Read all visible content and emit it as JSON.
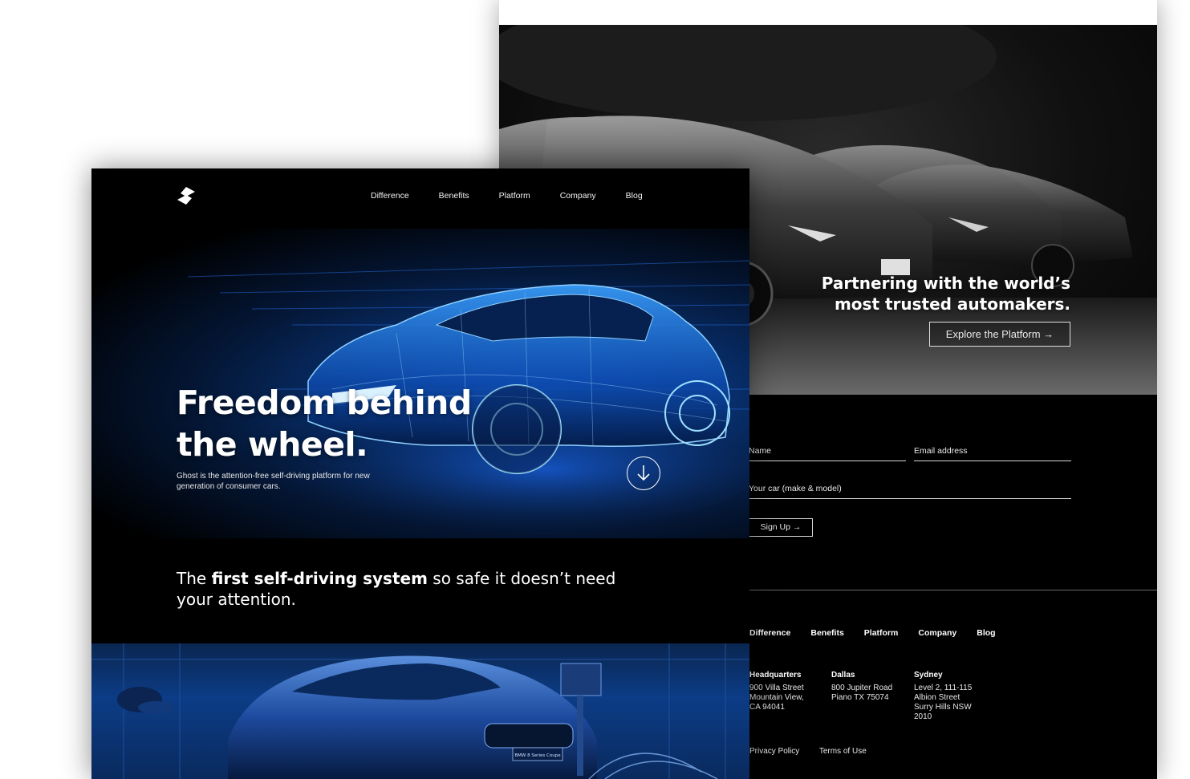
{
  "brand": {
    "accent_blue": "#1a6cff",
    "background": "#000000",
    "logo_icon": "ghost-logo-icon"
  },
  "nav": {
    "items": [
      "Difference",
      "Benefits",
      "Platform",
      "Company",
      "Blog"
    ]
  },
  "hero": {
    "title": "Freedom behind\nthe wheel.",
    "subtitle": "Ghost is the attention-free self-driving platform for new generation of consumer cars.",
    "scroll_icon": "arrow-down-circle-icon"
  },
  "tagline": {
    "prefix": "The ",
    "emphasis": "first self-driving system",
    "suffix": " so safe it doesn’t need your attention."
  },
  "showroom": {
    "plate_text": "BMW 8 Series Coupe"
  },
  "partners": {
    "heading": "Partnering with the world’s\nmost trusted automakers.",
    "cta_label": "Explore the Platform →"
  },
  "signup_form": {
    "name_placeholder": "Name",
    "email_placeholder": "Email address",
    "car_placeholder": "Your car (make & model)",
    "submit_label": "Sign Up →"
  },
  "footer": {
    "nav": [
      "Difference",
      "Benefits",
      "Platform",
      "Company",
      "Blog"
    ],
    "offices": [
      {
        "city": "Headquarters",
        "address": "900 Villa Street\nMountain View,\nCA 94041"
      },
      {
        "city": "Dallas",
        "address": "800  Jupiter Road\nPiano TX 75074"
      },
      {
        "city": "Sydney",
        "address": "Level 2, 111-115\nAlbion Street\nSurry Hills NSW\n2010"
      }
    ],
    "legal": [
      "Privacy Policy",
      "Terms of Use"
    ]
  }
}
